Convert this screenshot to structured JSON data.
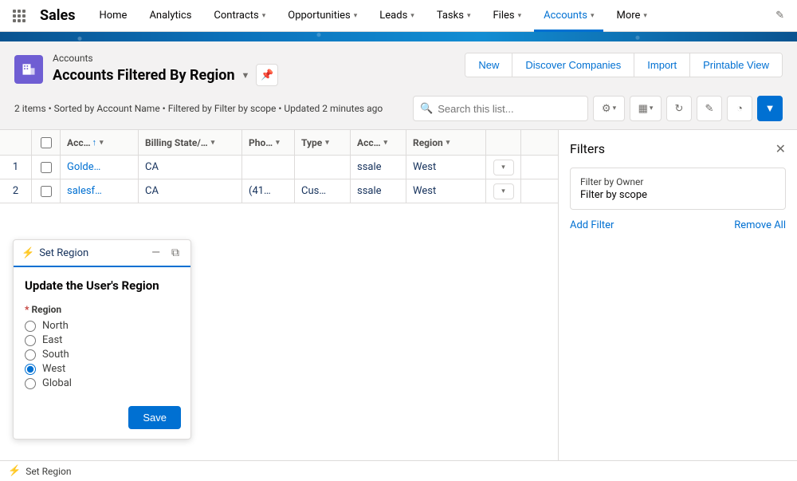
{
  "app_name": "Sales",
  "nav": {
    "items": [
      {
        "label": "Home",
        "dropdown": false
      },
      {
        "label": "Analytics",
        "dropdown": false
      },
      {
        "label": "Contracts",
        "dropdown": true
      },
      {
        "label": "Opportunities",
        "dropdown": true
      },
      {
        "label": "Leads",
        "dropdown": true
      },
      {
        "label": "Tasks",
        "dropdown": true
      },
      {
        "label": "Files",
        "dropdown": true
      },
      {
        "label": "Accounts",
        "dropdown": true,
        "active": true
      },
      {
        "label": "More",
        "dropdown": true
      }
    ]
  },
  "header": {
    "object_label": "Accounts",
    "view_name": "Accounts Filtered By Region",
    "meta": "2 items • Sorted by Account Name • Filtered by Filter by scope • Updated 2 minutes ago",
    "actions": [
      "New",
      "Discover Companies",
      "Import",
      "Printable View"
    ],
    "search_placeholder": "Search this list..."
  },
  "columns": [
    "Acc…",
    "Billing State/…",
    "Pho…",
    "Type",
    "Acc…",
    "Region"
  ],
  "rows": [
    {
      "num": "1",
      "name": "Golde…",
      "state": "CA",
      "phone": "",
      "type": "",
      "owner": "ssale",
      "region": "West"
    },
    {
      "num": "2",
      "name": "salesf…",
      "state": "CA",
      "phone": "(41…",
      "type": "Cus…",
      "owner": "ssale",
      "region": "West"
    }
  ],
  "filters": {
    "title": "Filters",
    "card_label": "Filter by Owner",
    "card_value": "Filter by scope",
    "add": "Add Filter",
    "remove": "Remove All"
  },
  "modal": {
    "title": "Set Region",
    "heading": "Update the User's Region",
    "field_label": "Region",
    "options": [
      "North",
      "East",
      "South",
      "West",
      "Global"
    ],
    "selected": "West",
    "save": "Save"
  },
  "bottom_bar": "Set Region"
}
